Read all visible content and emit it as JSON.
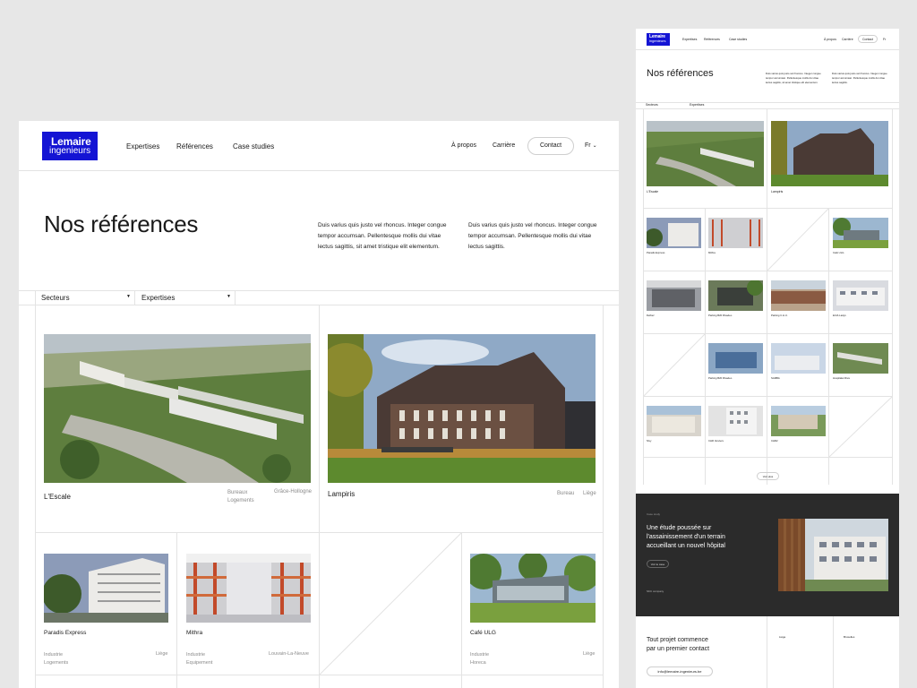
{
  "logo": {
    "line1": "Lemaire",
    "line2": "ingenieurs"
  },
  "nav": {
    "expertises": "Expertises",
    "references": "Références",
    "case_studies": "Case studies",
    "apropos": "À propos",
    "carriere": "Carrière",
    "contact": "Contact",
    "lang": "Fr"
  },
  "hero": {
    "title": "Nos références",
    "para1": [
      "Duis varius quis justo vel rhoncus. Integer congue",
      "tempor accumsan. Pellentesque mollis dui vitae",
      "lectus sagittis, sit amet tristique elit elementum."
    ],
    "para2": [
      "Duis varius quis justo vel rhoncus. Integer congue",
      "tempor accumsan. Pellentesque mollis dui vitae",
      "lectus sagittis."
    ]
  },
  "filters": {
    "secteurs": "Secteurs",
    "expertises": "Expertises"
  },
  "featured": [
    {
      "name": "L'Escale",
      "tags": [
        "Bureaux",
        "Logements"
      ],
      "location": "Grâce-Hollogne"
    },
    {
      "name": "Lampiris",
      "tags": [
        "Bureau"
      ],
      "location": "Liège"
    }
  ],
  "projects": [
    {
      "name": "Paradis Express",
      "tags": [
        "Industrie",
        "Logements"
      ],
      "location": "Liège"
    },
    {
      "name": "Mithra",
      "tags": [
        "Industrie",
        "Equipement"
      ],
      "location": "Louvain-La-Neuve"
    },
    {
      "name": "Café ULG",
      "tags": [
        "Industrie",
        "Horeca"
      ],
      "location": "Liège"
    }
  ],
  "mini_projects": [
    {
      "name": "Delhez"
    },
    {
      "name": "Parking B20 Rivadeo"
    },
    {
      "name": "Parking C.H.U."
    },
    {
      "name": "ECIA Ladys"
    },
    {
      "name": "Parking B20 Rivadeo"
    },
    {
      "name": "SAMBA"
    },
    {
      "name": "Hospitalet Riva"
    },
    {
      "name": "Nivy"
    },
    {
      "name": "CHR Verviers"
    },
    {
      "name": "CHR2"
    }
  ],
  "more_button": "Voir plus",
  "case_study": {
    "kicker": "Case study",
    "title": [
      "Une étude poussée sur",
      "l'assainissement d'un terrain",
      "accueillant un nouvel hôpital"
    ],
    "cta": "Voir le case",
    "company": "SKC company"
  },
  "footer": {
    "title": [
      "Tout projet commence",
      "par un premier contact"
    ],
    "email": "info@lemaire-ingenieurs.be",
    "office1": "Liège",
    "office2": "Bruxelles"
  },
  "colors": {
    "brand": "#1414d4",
    "dark_section": "#2b2b2b",
    "background": "#e7e7e7"
  }
}
